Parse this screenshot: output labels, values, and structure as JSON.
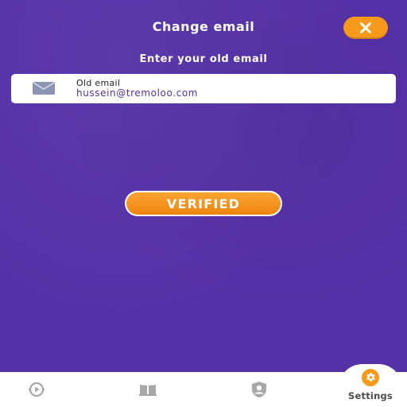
{
  "header": {
    "title": "Change email",
    "close_icon": "close-icon"
  },
  "form": {
    "subtitle": "Enter your old email",
    "field_label": "Old email",
    "field_value": "hussein@tremoloo.com",
    "field_icon": "mail-icon"
  },
  "status": {
    "badge_label": "VERIFIED"
  },
  "bottom_nav": {
    "items": [
      {
        "icon": "play-circle-icon",
        "label": ""
      },
      {
        "icon": "book-icon",
        "label": ""
      },
      {
        "icon": "profile-icon",
        "label": ""
      },
      {
        "icon": "gear-icon",
        "label": "Settings",
        "active": true
      }
    ]
  },
  "colors": {
    "background": "#5531a7",
    "accent": "#f79a1c",
    "card": "#ffffff",
    "email_text": "#5531a7"
  }
}
